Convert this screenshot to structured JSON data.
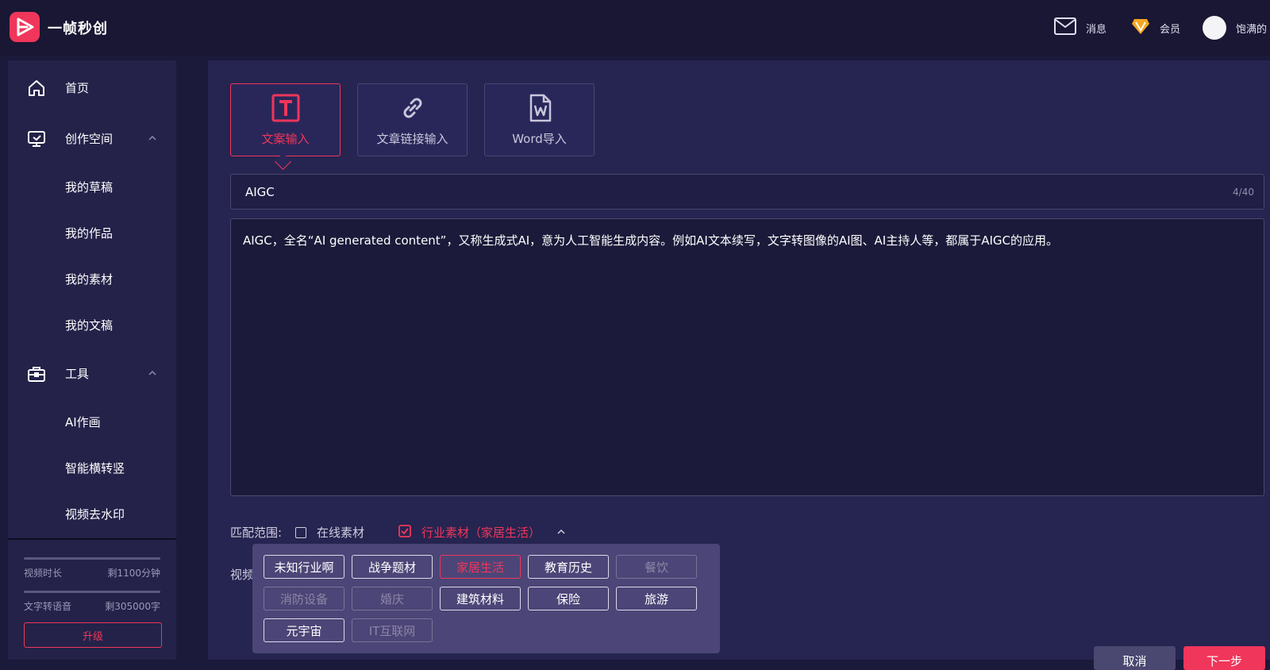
{
  "app": {
    "title": "一帧秒创"
  },
  "topbar": {
    "messages": "消息",
    "vip": "会员",
    "username": "饱满的"
  },
  "sidebar": {
    "home": "首页",
    "workspace": {
      "label": "创作空间",
      "items": [
        "我的草稿",
        "我的作品",
        "我的素材",
        "我的文稿"
      ]
    },
    "tools": {
      "label": "工具",
      "items": [
        "AI作画",
        "智能横转竖",
        "视频去水印"
      ]
    },
    "quota": [
      {
        "label": "视频时长",
        "value": "剩1100分钟",
        "fill": 1.0
      },
      {
        "label": "文字转语音",
        "value": "剩305000字",
        "fill": 1.0
      }
    ],
    "upgrade": "升级"
  },
  "tabs": [
    {
      "label": "文案输入",
      "icon": "text-icon",
      "active": true
    },
    {
      "label": "文章链接输入",
      "icon": "link-icon",
      "active": false
    },
    {
      "label": "Word导入",
      "icon": "word-doc-icon",
      "active": false
    }
  ],
  "title_input": {
    "value": "AIGC",
    "counter": "4/40"
  },
  "content": {
    "value": "AIGC，全名“AI generated content”，又称生成式AI，意为人工智能生成内容。例如AI文本续写，文字转图像的AI图、AI主持人等，都属于AIGC的应用。"
  },
  "match": {
    "label": "匹配范围:",
    "online": {
      "label": "在线素材",
      "checked": false
    },
    "industry": {
      "label": "行业素材（家居生活）",
      "checked": true
    }
  },
  "video_label": "视频",
  "industry_tags": [
    {
      "label": "未知行业啊",
      "state": "normal"
    },
    {
      "label": "战争题材",
      "state": "normal"
    },
    {
      "label": "家居生活",
      "state": "active"
    },
    {
      "label": "教育历史",
      "state": "normal"
    },
    {
      "label": "餐饮",
      "state": "disabled"
    },
    {
      "label": "消防设备",
      "state": "disabled"
    },
    {
      "label": "婚庆",
      "state": "disabled"
    },
    {
      "label": "建筑材料",
      "state": "normal"
    },
    {
      "label": "保险",
      "state": "normal"
    },
    {
      "label": "旅游",
      "state": "normal"
    },
    {
      "label": "元宇宙",
      "state": "normal"
    },
    {
      "label": "IT互联网",
      "state": "disabled"
    }
  ],
  "actions": {
    "cancel": "取消",
    "next": "下一步"
  },
  "colors": {
    "accent": "#f0365a",
    "background": "#1b1a3a",
    "panel": "#262450",
    "sidebar": "#242249"
  }
}
